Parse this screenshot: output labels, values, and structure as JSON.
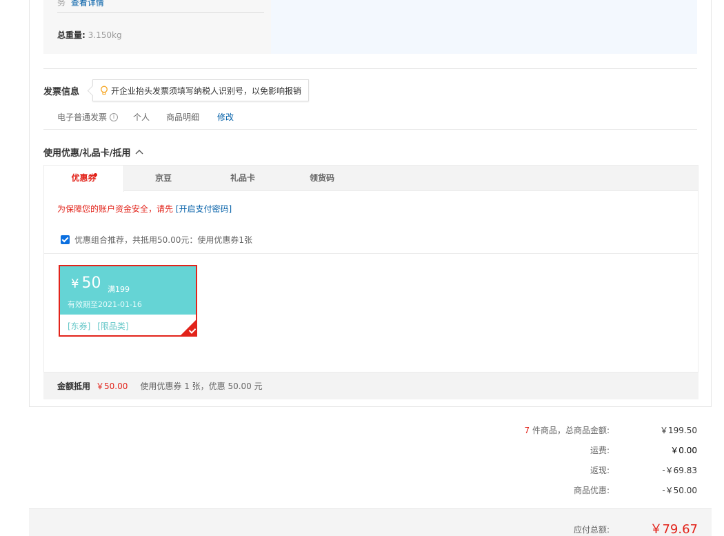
{
  "shipping": {
    "service_label": "务",
    "details_link": "查看详情",
    "weight_label": "总重量:",
    "weight_value": "3.150kg"
  },
  "invoice": {
    "title": "发票信息",
    "tip": "开企业抬头发票须填写纳税人识别号，以免影响报销",
    "type": "电子普通发票",
    "info_icon": "i",
    "holder": "个人",
    "content": "商品明细",
    "edit_link": "修改"
  },
  "coupons": {
    "title": "使用优惠/礼品卡/抵用",
    "tabs": [
      {
        "label": "优惠券",
        "active": true
      },
      {
        "label": "京豆",
        "active": false
      },
      {
        "label": "礼品卡",
        "active": false
      },
      {
        "label": "领货码",
        "active": false
      }
    ],
    "warning_text": "为保障您的账户资金安全，请先",
    "warning_link": "[开启支付密码]",
    "combo_text": "优惠组合推荐，共抵用50.00元：使用优惠券1张",
    "card": {
      "currency": "¥",
      "amount": "50",
      "condition": "满199",
      "expiry": "有效期至2021-01-16",
      "tag1": "[东券]",
      "tag2": "[限品类]",
      "color": "#65d4d5",
      "selected": true
    },
    "summary_label": "金额抵用",
    "summary_amount": "￥50.00",
    "summary_desc": "使用优惠券 1 张，优惠 50.00 元"
  },
  "totals": {
    "count": "7",
    "count_suffix": "件商品，总商品金额:",
    "goods_amount": "￥199.50",
    "shipping_label": "运费:",
    "shipping_amount": "￥0.00",
    "cashback_label": "返现:",
    "cashback_amount": "-￥69.83",
    "discount_label": "商品优惠:",
    "discount_amount": "-￥50.00",
    "payable_label": "应付总额:",
    "payable_amount": "￥79.67"
  },
  "colors": {
    "accent_red": "#e2231a",
    "link_blue": "#005ea7",
    "coupon_teal": "#65d4d5"
  }
}
